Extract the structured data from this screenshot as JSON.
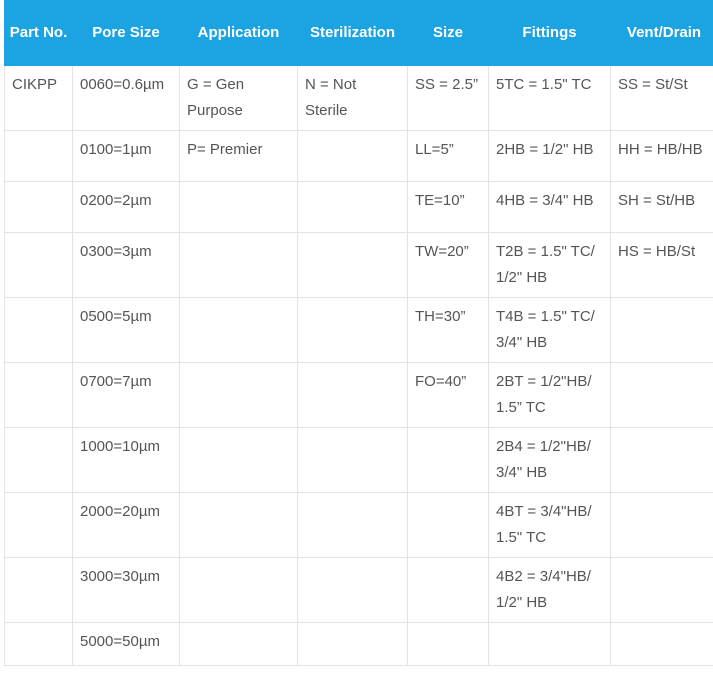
{
  "headers": [
    "Part No.",
    "Pore Size",
    "Application",
    "Sterilization",
    "Size",
    "Fittings",
    "Vent/Drain"
  ],
  "rows": [
    [
      "CIKPP",
      "0060=0.6µm",
      "G = Gen Purpose",
      "N = Not Sterile",
      "SS = 2.5”",
      "5TC = 1.5\" TC",
      "SS = St/St"
    ],
    [
      "",
      "0100=1µm",
      "P= Premier",
      "",
      "LL=5”",
      "2HB = 1/2\" HB",
      "HH = HB/HB"
    ],
    [
      "",
      "0200=2µm",
      "",
      "",
      "TE=10”",
      "4HB = 3/4\" HB",
      "SH = St/HB"
    ],
    [
      "",
      "0300=3µm",
      "",
      "",
      "TW=20”",
      "T2B = 1.5\" TC/ 1/2\" HB",
      "HS = HB/St"
    ],
    [
      "",
      "0500=5µm",
      "",
      "",
      "TH=30”",
      "T4B = 1.5\" TC/ 3/4\" HB",
      ""
    ],
    [
      "",
      "0700=7µm",
      "",
      "",
      "FO=40”",
      "2BT = 1/2\"HB/ 1.5” TC",
      ""
    ],
    [
      "",
      "1000=10µm",
      "",
      "",
      "",
      "2B4 = 1/2\"HB/ 3/4\" HB",
      ""
    ],
    [
      "",
      "2000=20µm",
      "",
      "",
      "",
      "4BT = 3/4\"HB/ 1.5\" TC",
      ""
    ],
    [
      "",
      "3000=30µm",
      "",
      "",
      "",
      "4B2 = 3/4\"HB/ 1/2\" HB",
      ""
    ],
    [
      "",
      "5000=50µm",
      "",
      "",
      "",
      "",
      ""
    ]
  ]
}
